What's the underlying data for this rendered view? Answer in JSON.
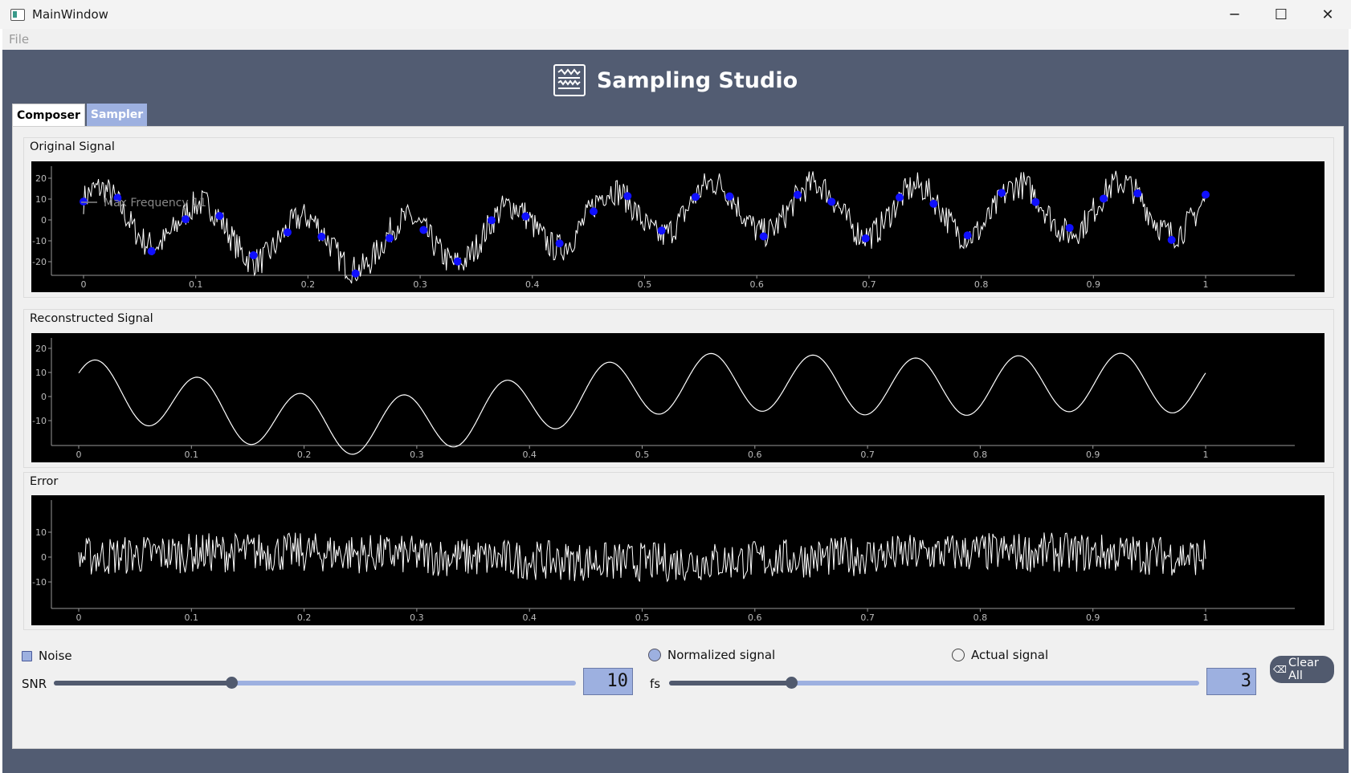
{
  "window": {
    "title": "MainWindow",
    "minimize": "─",
    "maximize": "☐",
    "close": "✕"
  },
  "menu": {
    "file": "File"
  },
  "header": {
    "app_title": "Sampling Studio"
  },
  "tabs": [
    {
      "label": "Composer",
      "active": true
    },
    {
      "label": "Sampler",
      "active": false
    }
  ],
  "plots": {
    "original": {
      "title": "Original Signal",
      "legend": "Max Frequency 11",
      "yticks": [
        "20",
        "10",
        "0",
        "-10",
        "-20"
      ],
      "xticks": [
        "0",
        "0.1",
        "0.2",
        "0.3",
        "0.4",
        "0.5",
        "0.6",
        "0.7",
        "0.8",
        "0.9",
        "1"
      ]
    },
    "reconstructed": {
      "title": "Reconstructed Signal",
      "yticks": [
        "20",
        "10",
        "0",
        "-10"
      ],
      "xticks": [
        "0",
        "0.1",
        "0.2",
        "0.3",
        "0.4",
        "0.5",
        "0.6",
        "0.7",
        "0.8",
        "0.9",
        "1"
      ]
    },
    "error": {
      "title": "Error",
      "yticks": [
        "10",
        "0",
        "-10"
      ],
      "xticks": [
        "0",
        "0.1",
        "0.2",
        "0.3",
        "0.4",
        "0.5",
        "0.6",
        "0.7",
        "0.8",
        "0.9",
        "1"
      ]
    }
  },
  "controls": {
    "noise_label": "Noise",
    "noise_checked": true,
    "normalized_label": "Normalized signal",
    "normalized_selected": true,
    "actual_label": "Actual signal",
    "actual_selected": false,
    "snr_label": "SNR",
    "snr_slider_fraction": 0.34,
    "snr_value": "10",
    "fs_label": "fs",
    "fs_slider_fraction": 0.23,
    "fs_value": "3",
    "clear_label": "Clear All"
  },
  "colors": {
    "background": "#525c72",
    "accent": "#9db0e0",
    "sample_dot": "#1010ff",
    "plot_bg": "#000000"
  },
  "icons": {
    "app": "window-app-icon",
    "logo": "waveform-monitor-icon",
    "clear": "eraser-icon"
  }
}
